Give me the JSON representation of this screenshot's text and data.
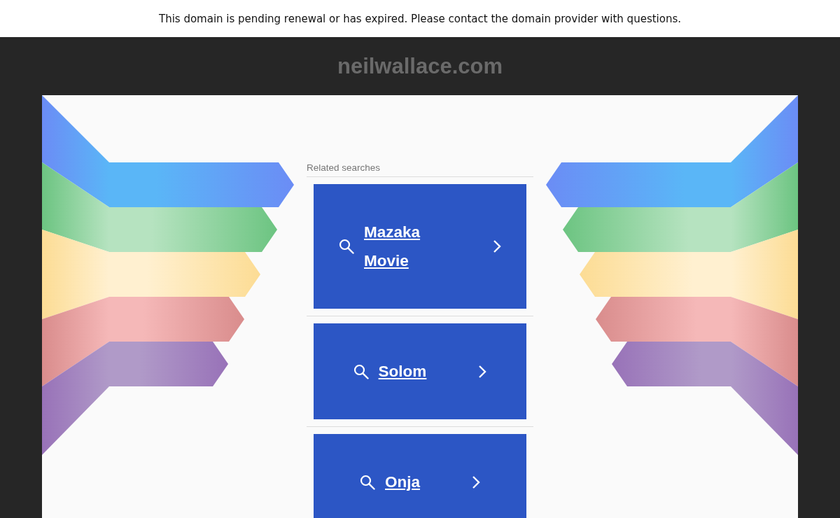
{
  "banner": {
    "text": "This domain is pending renewal or has expired. Please contact the domain provider with questions."
  },
  "domain": "neilwallace.com",
  "related": {
    "heading": "Related searches",
    "links": [
      {
        "label": "Mazaka Movie"
      },
      {
        "label": "Solom"
      },
      {
        "label": "Onja"
      }
    ]
  }
}
